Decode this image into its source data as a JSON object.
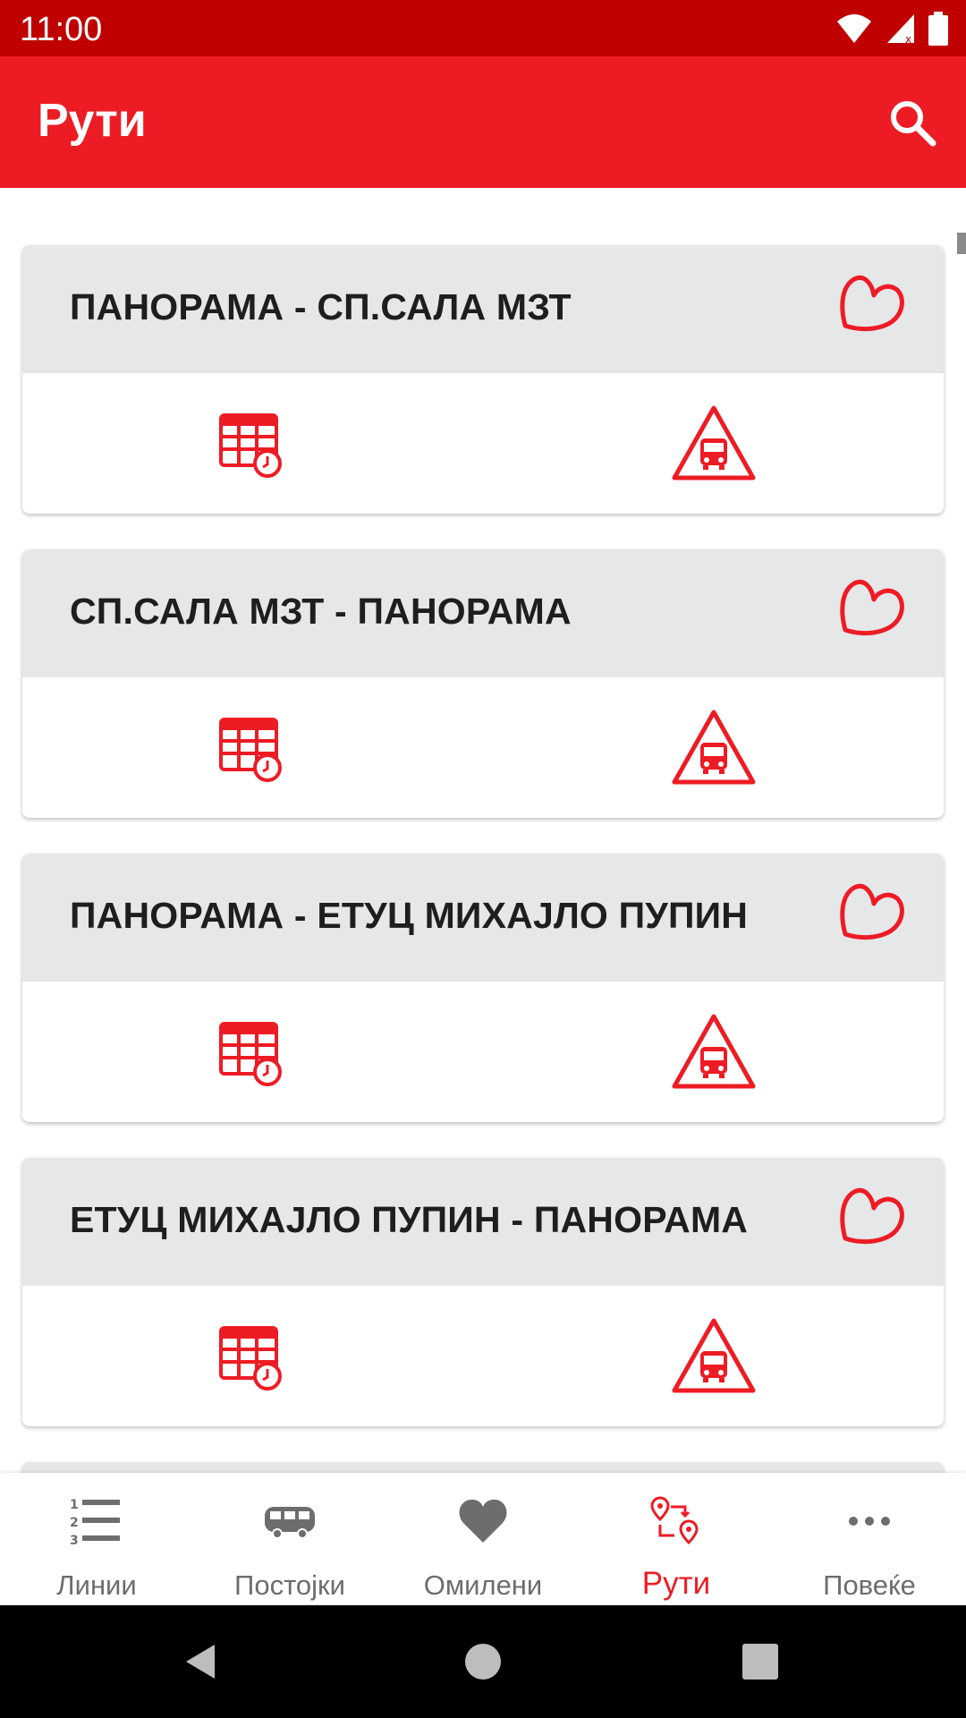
{
  "status_bar": {
    "time": "11:00"
  },
  "app_bar": {
    "title": "Рути"
  },
  "routes": [
    {
      "title": "ПАНОРАМА - СП.САЛА МЗТ"
    },
    {
      "title": "СП.САЛА МЗТ - ПАНОРАМА"
    },
    {
      "title": "ПАНОРАМА - ЕТУЦ МИХАЈЛО ПУПИН"
    },
    {
      "title": "ЕТУЦ МИХАЈЛО ПУПИН - ПАНОРАМА"
    }
  ],
  "bottom_nav": {
    "items": [
      {
        "label": "Линии",
        "icon": "numbered-list-icon"
      },
      {
        "label": "Постојки",
        "icon": "bus-icon"
      },
      {
        "label": "Омилени",
        "icon": "heart-icon"
      },
      {
        "label": "Рути",
        "icon": "route-icon",
        "active": true
      },
      {
        "label": "Повеќе",
        "icon": "more-dots-icon"
      }
    ]
  },
  "colors": {
    "primary": "#ed1c24",
    "status_bar": "#c00000",
    "card_header": "#e6e7e9",
    "inactive": "#6d6d6d"
  }
}
